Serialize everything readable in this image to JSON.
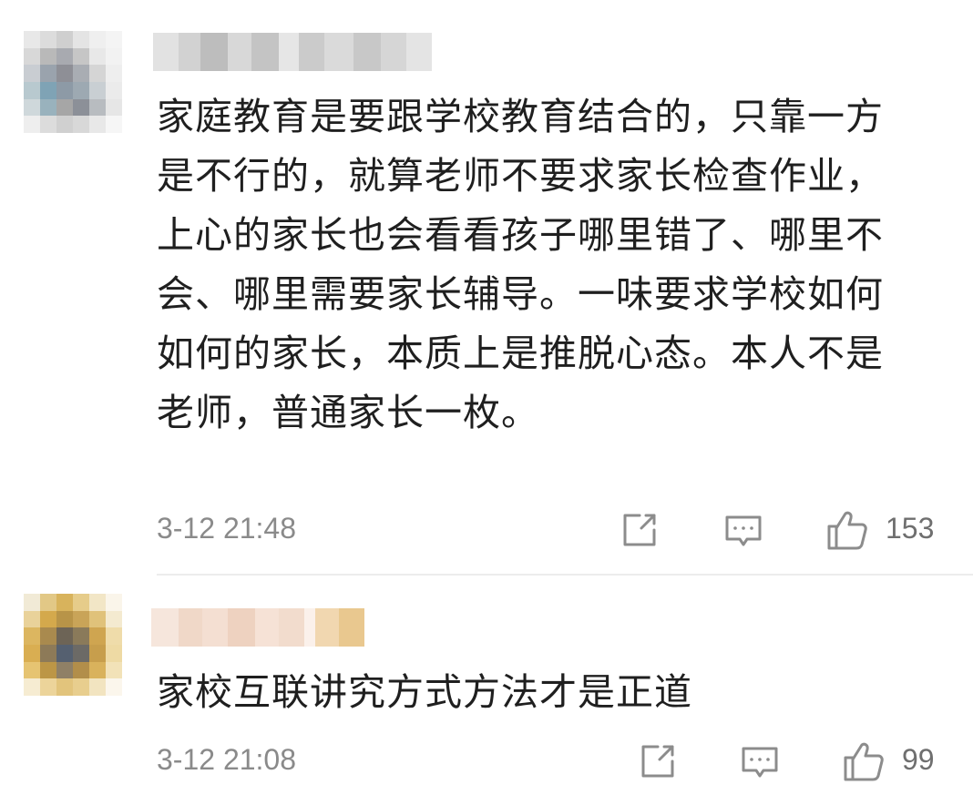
{
  "comments": [
    {
      "text": "家庭教育是要跟学校教育结合的，只靠一方是不行的，就算老师不要求家长检查作业，上心的家长也会看看孩子哪里错了、哪里不会、哪里需要家长辅导。一味要求学校如何如何的家长，本质上是推脱心态。本人不是老师，普通家长一枚。",
      "timestamp": "3-12 21:48",
      "likes": "153"
    },
    {
      "text": "家校互联讲究方式方法才是正道",
      "timestamp": "3-12 21:08",
      "likes": "99"
    }
  ],
  "icons": {
    "share": "share-icon",
    "reply": "comment-icon",
    "like": "thumbs-up-icon"
  },
  "colors": {
    "text": "#1f1f1f",
    "meta": "#8a8a8a",
    "icon": "#8c8c8c"
  }
}
